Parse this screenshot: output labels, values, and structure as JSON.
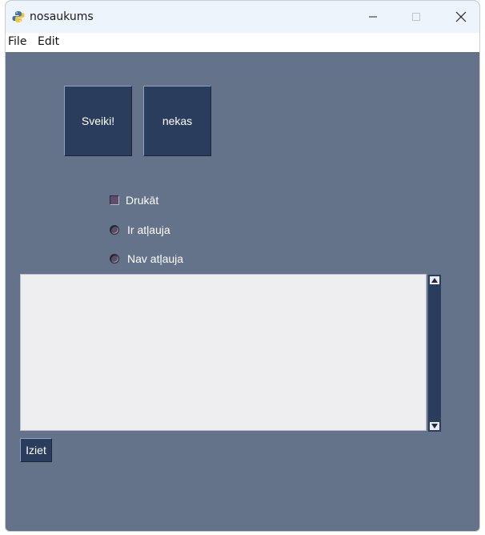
{
  "window": {
    "title": "nosaukums",
    "app_icon": "python-icon",
    "controls": {
      "minimize_icon": "minimize-icon",
      "maximize_icon": "maximize-icon",
      "close_icon": "close-icon"
    }
  },
  "menubar": {
    "items": [
      {
        "label": "File"
      },
      {
        "label": "Edit"
      }
    ]
  },
  "buttons": {
    "sveiki_label": "Sveiki!",
    "nekas_label": "nekas",
    "iziet_label": "Iziet"
  },
  "options": {
    "checkbox": {
      "label": "Drukāt",
      "checked": false
    },
    "radios": [
      {
        "label": "Ir atļauja",
        "selected": false
      },
      {
        "label": "Nav atļauja",
        "selected": false
      }
    ]
  },
  "text_area": {
    "value": ""
  },
  "colors": {
    "background": "#647389",
    "button": "#2a3d5c",
    "titlebar": "#eef4fb",
    "text_area": "#eeeef0"
  }
}
